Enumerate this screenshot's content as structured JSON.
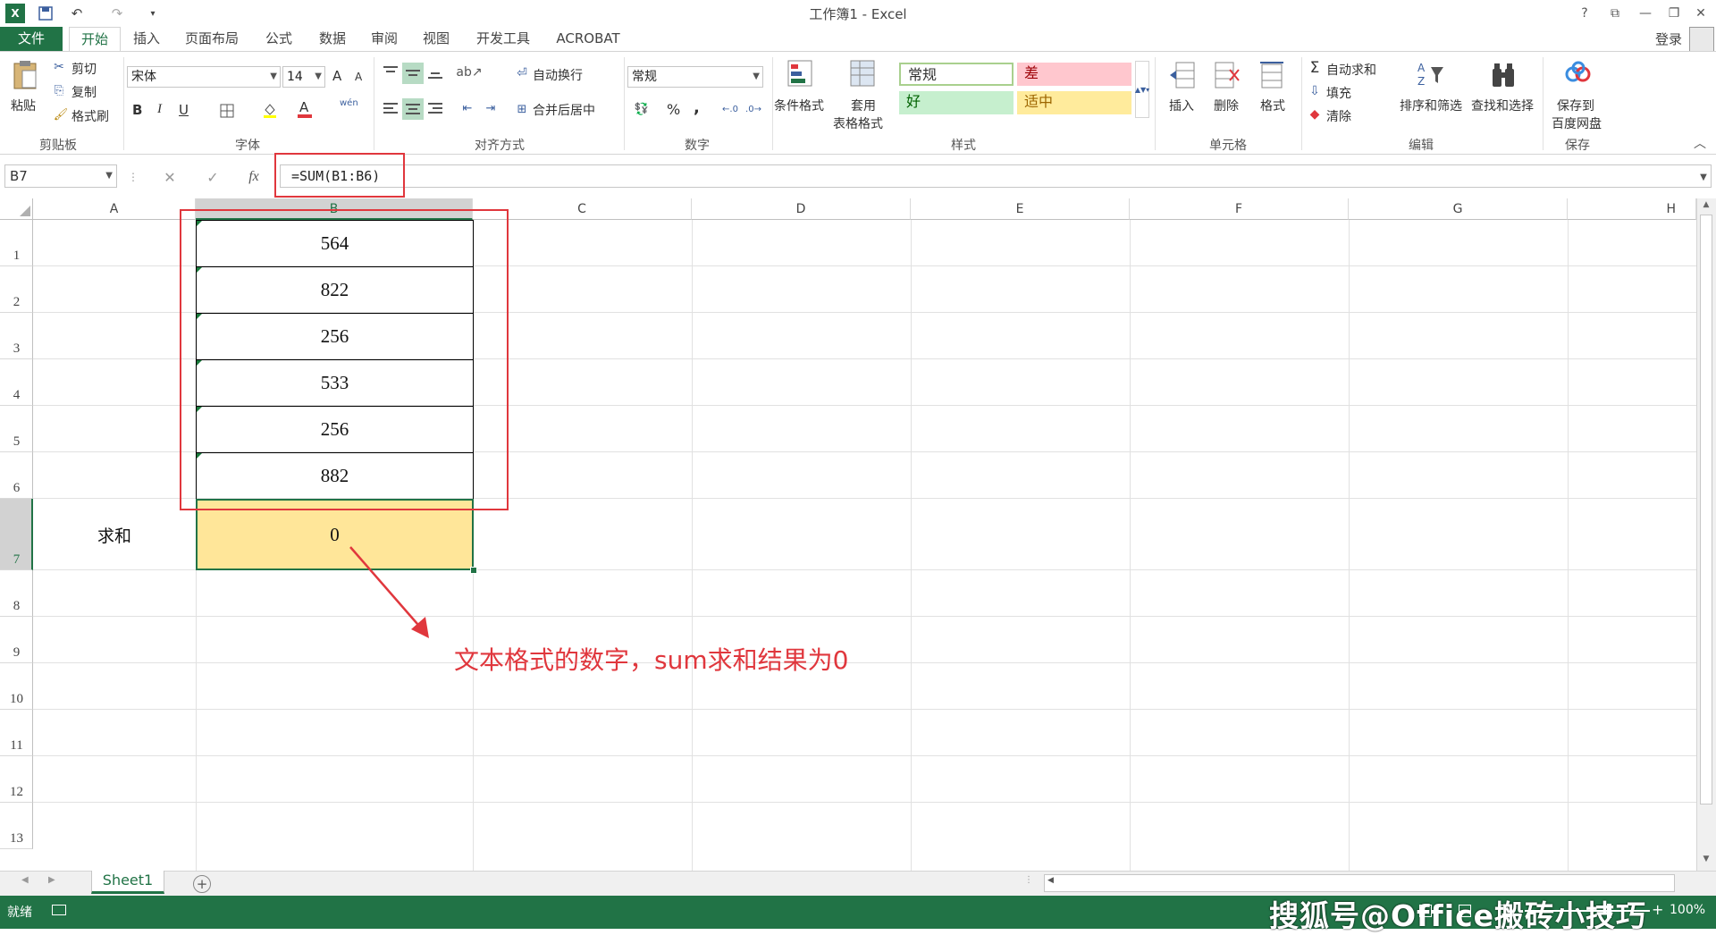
{
  "window": {
    "title": "工作簿1 - Excel"
  },
  "title_buttons": {
    "help": "?",
    "restore": "⧉",
    "minimize": "—",
    "maximize": "❐",
    "close": "✕"
  },
  "tabs": [
    {
      "label": "文件"
    },
    {
      "label": "开始"
    },
    {
      "label": "插入"
    },
    {
      "label": "页面布局"
    },
    {
      "label": "公式"
    },
    {
      "label": "数据"
    },
    {
      "label": "审阅"
    },
    {
      "label": "视图"
    },
    {
      "label": "开发工具"
    },
    {
      "label": "ACROBAT"
    }
  ],
  "account": {
    "signin": "登录"
  },
  "ribbon": {
    "clipboard": {
      "paste": "粘贴",
      "cut": "剪切",
      "copy": "复制",
      "format_painter": "格式刷",
      "label": "剪贴板"
    },
    "font": {
      "name": "宋体",
      "size": "14",
      "label": "字体",
      "grow": "A",
      "shrink": "A",
      "bold": "B",
      "italic": "I",
      "underline": "U",
      "font_color_glyph": "A",
      "phonetic": "wén"
    },
    "alignment": {
      "wrap": "自动换行",
      "merge": "合并后居中",
      "label": "对齐方式"
    },
    "number": {
      "format": "常规",
      "label": "数字",
      "percent": "%",
      "comma": ","
    },
    "styles": {
      "conditional": "条件格式",
      "table_a": "套用",
      "table_b": "表格格式",
      "normal": "常规",
      "bad": "差",
      "good": "好",
      "neutral": "适中",
      "label": "样式"
    },
    "cells": {
      "insert": "插入",
      "delete": "删除",
      "format": "格式",
      "label": "单元格"
    },
    "editing": {
      "autosum": "自动求和",
      "fill": "填充",
      "clear": "清除",
      "sort": "排序和筛选",
      "find": "查找和选择",
      "label": "编辑"
    },
    "save": {
      "save_a": "保存到",
      "save_b": "百度网盘",
      "label": "保存"
    }
  },
  "formula_bar": {
    "name_box": "B7",
    "fx": "fx",
    "formula": "=SUM(B1:B6)"
  },
  "columns": [
    "A",
    "B",
    "C",
    "D",
    "E",
    "F",
    "G",
    "H"
  ],
  "rows": [
    "1",
    "2",
    "3",
    "4",
    "5",
    "6",
    "7",
    "8",
    "9",
    "10",
    "11",
    "12",
    "13"
  ],
  "cells": {
    "B1": "564",
    "B2": "822",
    "B3": "256",
    "B4": "533",
    "B5": "256",
    "B6": "882",
    "A7": "求和",
    "B7": "0"
  },
  "annotation": {
    "text": "文本格式的数字，sum求和结果为0"
  },
  "sheets": [
    {
      "name": "Sheet1"
    }
  ],
  "status": {
    "ready": "就绪",
    "zoom": "100%"
  },
  "watermark": "搜狐号@Office搬砖小技巧",
  "colors": {
    "excel_green": "#217346",
    "highlight_red": "#e0373d",
    "cell_yellow": "#ffe699",
    "good_bg": "#c6efce",
    "bad_bg": "#ffc7ce",
    "neutral_bg": "#ffeb9c"
  }
}
